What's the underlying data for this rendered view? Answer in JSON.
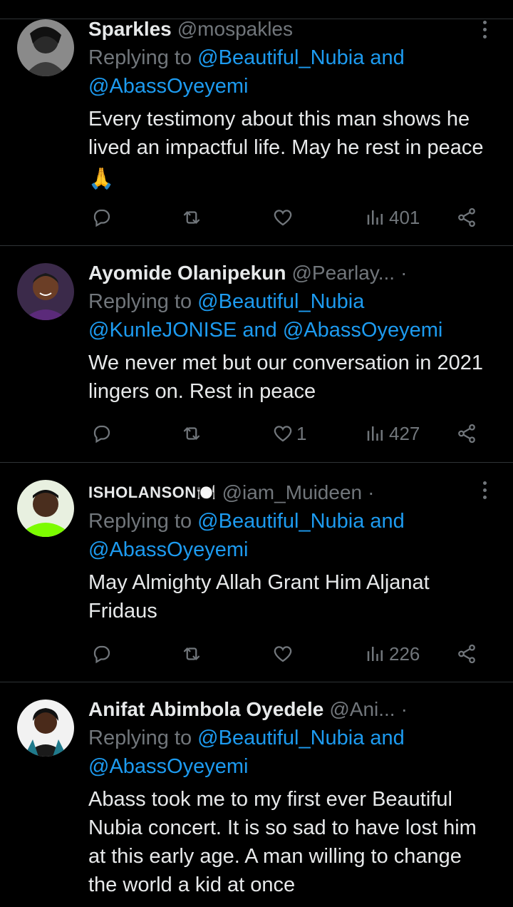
{
  "tweets": [
    {
      "name": "Sparkles",
      "handle": "@mospakles",
      "reply_prefix": "Replying to ",
      "mentions_line1": "@Beautiful_Nubia and",
      "mentions_line2": "@AbassOyeyemi",
      "text": "Every testimony about this man shows he lived an impactful life. May he rest in peace",
      "emoji": "🙏",
      "views": "401",
      "likes": ""
    },
    {
      "name": "Ayomide Olanipekun",
      "handle": "@Pearlay...",
      "separator": "·",
      "reply_prefix": "Replying to ",
      "mentions_line1": "@Beautiful_Nubia",
      "mentions_line2": "@KunleJONISE and @AbassOyeyemi",
      "text": "We never met but our conversation in 2021 lingers on. Rest in peace",
      "views": "427",
      "likes": "1"
    },
    {
      "name": "ISHOLANSON🍽️",
      "handle": "@iam_Muideen",
      "separator": "·",
      "reply_prefix": "Replying to ",
      "mentions_line1": "@Beautiful_Nubia and",
      "mentions_line2": "@AbassOyeyemi",
      "text": "May Almighty Allah Grant Him Aljanat Fridaus",
      "views": "226",
      "likes": ""
    },
    {
      "name": "Anifat Abimbola Oyedele",
      "handle": "@Ani...",
      "separator": "·",
      "reply_prefix": "Replying to ",
      "mentions_line1": "@Beautiful_Nubia and",
      "mentions_line2": "@AbassOyeyemi",
      "text": "Abass took me to my first ever Beautiful Nubia concert. It is so sad to have lost him at this early age. A man willing to change the world a kid at once"
    }
  ],
  "icons": {
    "reply": "reply-icon",
    "retweet": "retweet-icon",
    "like": "heart-icon",
    "views": "views-icon",
    "share": "share-icon",
    "more": "more-options-icon"
  },
  "colors": {
    "background": "#000000",
    "text": "#e7e9ea",
    "secondary": "#71767b",
    "mention": "#1d9bf0",
    "divider": "#2f3336"
  }
}
